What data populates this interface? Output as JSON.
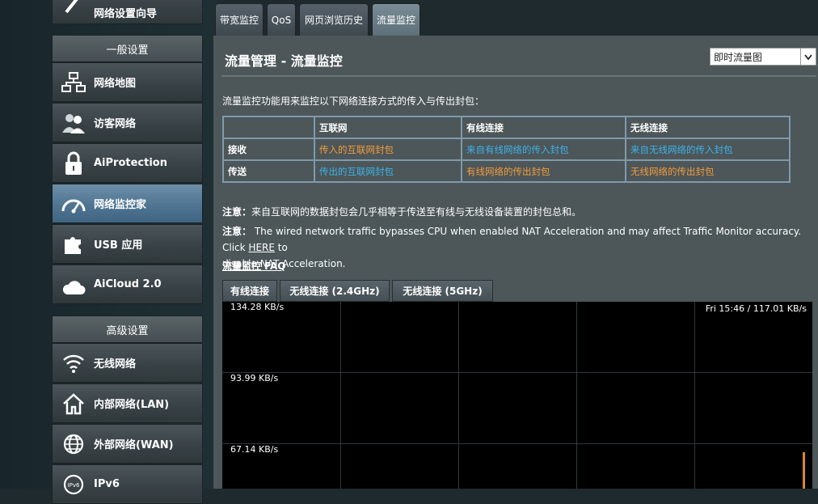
{
  "sidebar": {
    "top_item": {
      "label": "网络设置向导",
      "icon": "wizard-icon"
    },
    "general_header": "一般设置",
    "general_items": [
      {
        "label": "网络地图",
        "icon": "network-map-icon"
      },
      {
        "label": "访客网络",
        "icon": "guest-network-icon"
      },
      {
        "label": "AiProtection",
        "icon": "lock-icon"
      },
      {
        "label": "网络监控家",
        "icon": "gauge-icon",
        "active": true
      },
      {
        "label": "USB 应用",
        "icon": "puzzle-icon"
      },
      {
        "label": "AiCloud 2.0",
        "icon": "cloud-icon"
      }
    ],
    "advanced_header": "高级设置",
    "advanced_items": [
      {
        "label": "无线网络",
        "icon": "wifi-icon"
      },
      {
        "label": "内部网络(LAN)",
        "icon": "home-icon"
      },
      {
        "label": "外部网络(WAN)",
        "icon": "globe-icon"
      },
      {
        "label": "IPv6",
        "icon": "ipv6-icon"
      }
    ]
  },
  "tabs": [
    "带宽监控",
    "QoS",
    "网页浏览历史",
    "流量监控"
  ],
  "active_tab": "流量监控",
  "page": {
    "title": "流量管理 - 流量监控",
    "view_select": "即时流量图",
    "description": "流量监控功能用来监控以下网络连接方式的传入与传出封包："
  },
  "table": {
    "headers": [
      "",
      "互联网",
      "有线连接",
      "无线连接"
    ],
    "rows": [
      {
        "label": "接收",
        "cells": [
          "传入的互联网封包",
          "来自有线网络的传入封包",
          "来自无线网络的传入封包"
        ]
      },
      {
        "label": "传送",
        "cells": [
          "传出的互联网封包",
          "有线网络的传出封包",
          "无线网络的传出封包"
        ]
      }
    ]
  },
  "notes": {
    "note1_prefix": "注意：",
    "note1_text": "来自互联网的数据封包会几乎相等于传送至有线与无线设备装置的封包总和。",
    "note2_prefix": "注意：",
    "note2_text": " The wired network traffic bypasses CPU when enabled NAT Acceleration and may affect Traffic Monitor accuracy. Click ",
    "note2_link": "HERE",
    "note2_after": " to",
    "note2_line2": "disable NAT Acceleration."
  },
  "faq_link": "流量监控 FAQ",
  "sub_tabs": [
    "有线连接",
    "无线连接 (2.4GHz)",
    "无线连接 (5GHz)"
  ],
  "graph": {
    "y_labels": [
      "134.28 KB/s",
      "93.99 KB/s",
      "67.14 KB/s"
    ],
    "readout": "Fri 15:46 / 117.01 KB/s",
    "line_color": "#d98a1e"
  },
  "colors": {
    "orange": "#f39c3c",
    "blue": "#3cb3e8",
    "active_nav": "#4f7592"
  }
}
